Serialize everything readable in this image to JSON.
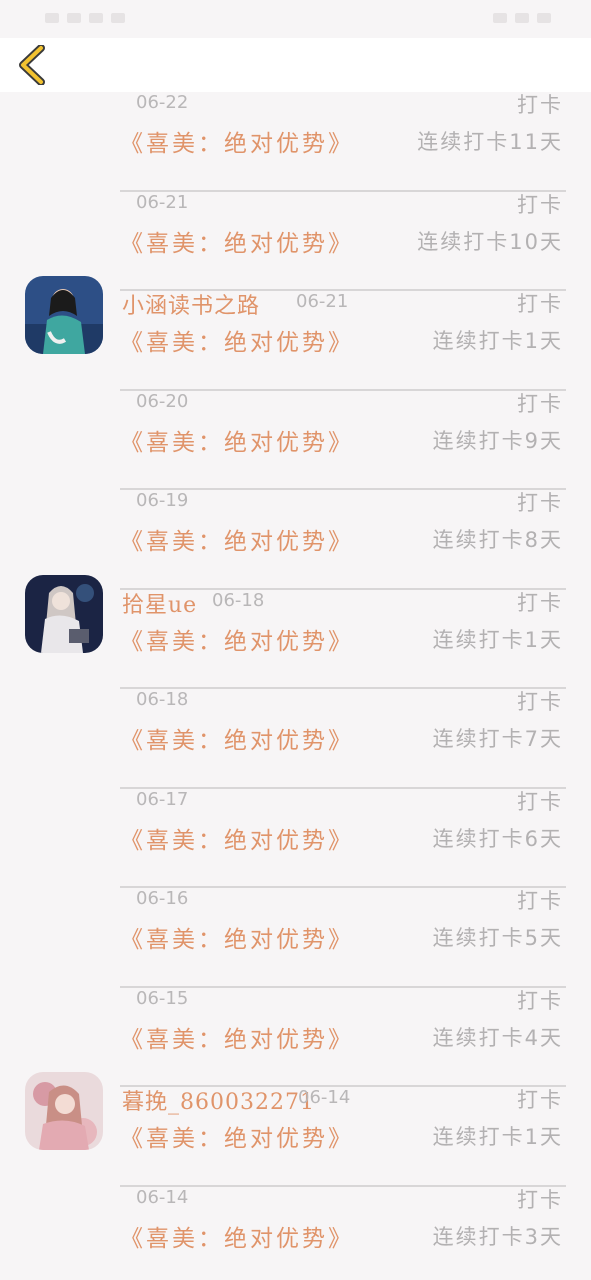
{
  "header": {
    "back_icon": "chevron-left-icon",
    "accent": "#f2c230"
  },
  "rows": [
    {
      "date": "06-22",
      "checkin": "打卡",
      "book": "《喜美：绝对优势》",
      "streak": "连续打卡11天"
    },
    {
      "date": "06-21",
      "checkin": "打卡",
      "book": "《喜美：绝对优势》",
      "streak": "连续打卡10天"
    },
    {
      "name": "小涵读书之路",
      "date": "06-21",
      "checkin": "打卡",
      "book": "《喜美：绝对优势》",
      "streak": "连续打卡1天"
    },
    {
      "date": "06-20",
      "checkin": "打卡",
      "book": "《喜美：绝对优势》",
      "streak": "连续打卡9天"
    },
    {
      "date": "06-19",
      "checkin": "打卡",
      "book": "《喜美：绝对优势》",
      "streak": "连续打卡8天"
    },
    {
      "name": "拾星ue",
      "date": "06-18",
      "checkin": "打卡",
      "book": "《喜美：绝对优势》",
      "streak": "连续打卡1天"
    },
    {
      "date": "06-18",
      "checkin": "打卡",
      "book": "《喜美：绝对优势》",
      "streak": "连续打卡7天"
    },
    {
      "date": "06-17",
      "checkin": "打卡",
      "book": "《喜美：绝对优势》",
      "streak": "连续打卡6天"
    },
    {
      "date": "06-16",
      "checkin": "打卡",
      "book": "《喜美：绝对优势》",
      "streak": "连续打卡5天"
    },
    {
      "date": "06-15",
      "checkin": "打卡",
      "book": "《喜美：绝对优势》",
      "streak": "连续打卡4天"
    },
    {
      "name": "暮挽_860032271",
      "date": "06-14",
      "checkin": "打卡",
      "book": "《喜美：绝对优势》",
      "streak": "连续打卡1天"
    },
    {
      "date": "06-14",
      "checkin": "打卡",
      "book": "《喜美：绝对优势》",
      "streak": "连续打卡3天"
    }
  ]
}
